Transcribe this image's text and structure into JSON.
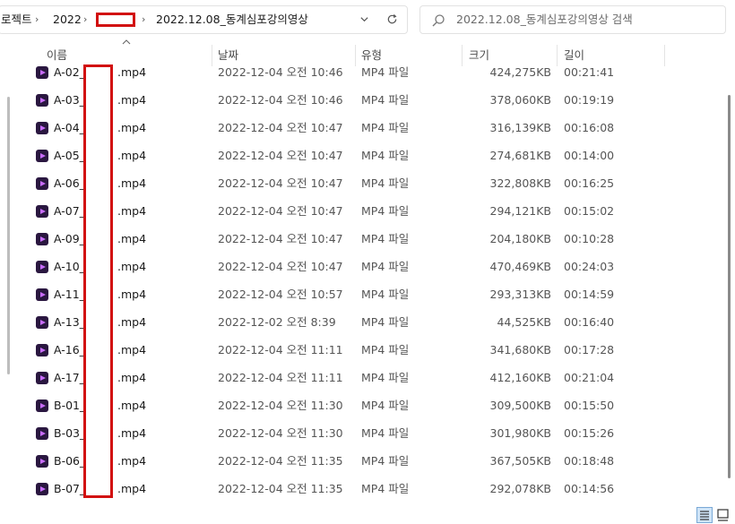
{
  "breadcrumb": {
    "items": [
      "로젝트",
      "2022",
      "2022.12.08_동계심포강의영상"
    ]
  },
  "search": {
    "placeholder": "2022.12.08_동계심포강의영상 검색"
  },
  "columns": {
    "name": "이름",
    "date": "날짜",
    "type": "유형",
    "size": "크기",
    "length": "길이"
  },
  "files": [
    {
      "prefix": "A-02_",
      "ext": ".mp4",
      "date": "2022-12-04 오전 10:46",
      "type": "MP4 파일",
      "size": "424,275KB",
      "length": "00:21:41"
    },
    {
      "prefix": "A-03_",
      "ext": ".mp4",
      "date": "2022-12-04 오전 10:46",
      "type": "MP4 파일",
      "size": "378,060KB",
      "length": "00:19:19"
    },
    {
      "prefix": "A-04_",
      "ext": ".mp4",
      "date": "2022-12-04 오전 10:47",
      "type": "MP4 파일",
      "size": "316,139KB",
      "length": "00:16:08"
    },
    {
      "prefix": "A-05_",
      "ext": ".mp4",
      "date": "2022-12-04 오전 10:47",
      "type": "MP4 파일",
      "size": "274,681KB",
      "length": "00:14:00"
    },
    {
      "prefix": "A-06_",
      "ext": ".mp4",
      "date": "2022-12-04 오전 10:47",
      "type": "MP4 파일",
      "size": "322,808KB",
      "length": "00:16:25"
    },
    {
      "prefix": "A-07_",
      "ext": ".mp4",
      "date": "2022-12-04 오전 10:47",
      "type": "MP4 파일",
      "size": "294,121KB",
      "length": "00:15:02"
    },
    {
      "prefix": "A-09_",
      "ext": ".mp4",
      "date": "2022-12-04 오전 10:47",
      "type": "MP4 파일",
      "size": "204,180KB",
      "length": "00:10:28"
    },
    {
      "prefix": "A-10_",
      "ext": ".mp4",
      "date": "2022-12-04 오전 10:47",
      "type": "MP4 파일",
      "size": "470,469KB",
      "length": "00:24:03"
    },
    {
      "prefix": "A-11_",
      "ext": ".mp4",
      "date": "2022-12-04 오전 10:57",
      "type": "MP4 파일",
      "size": "293,313KB",
      "length": "00:14:59"
    },
    {
      "prefix": "A-13_",
      "ext": ".mp4",
      "date": "2022-12-02 오전 8:39",
      "type": "MP4 파일",
      "size": "44,525KB",
      "length": "00:16:40"
    },
    {
      "prefix": "A-16_",
      "ext": ".mp4",
      "date": "2022-12-04 오전 11:11",
      "type": "MP4 파일",
      "size": "341,680KB",
      "length": "00:17:28"
    },
    {
      "prefix": "A-17_",
      "ext": ".mp4",
      "date": "2022-12-04 오전 11:11",
      "type": "MP4 파일",
      "size": "412,160KB",
      "length": "00:21:04"
    },
    {
      "prefix": "B-01_",
      "ext": ".mp4",
      "date": "2022-12-04 오전 11:30",
      "type": "MP4 파일",
      "size": "309,500KB",
      "length": "00:15:50"
    },
    {
      "prefix": "B-03_",
      "ext": ".mp4",
      "date": "2022-12-04 오전 11:30",
      "type": "MP4 파일",
      "size": "301,980KB",
      "length": "00:15:26"
    },
    {
      "prefix": "B-06_",
      "ext": ".mp4",
      "date": "2022-12-04 오전 11:35",
      "type": "MP4 파일",
      "size": "367,505KB",
      "length": "00:18:48"
    },
    {
      "prefix": "B-07_",
      "ext": ".mp4",
      "date": "2022-12-04 오전 11:35",
      "type": "MP4 파일",
      "size": "292,078KB",
      "length": "00:14:56"
    }
  ],
  "icons": {
    "file": "mp4-video-icon",
    "search": "search-icon",
    "refresh": "refresh-icon",
    "dropdown": "chevron-down-icon"
  },
  "colors": {
    "redaction": "#d21010",
    "file_icon": "#2a1740",
    "file_icon_play": "#c86cff"
  }
}
